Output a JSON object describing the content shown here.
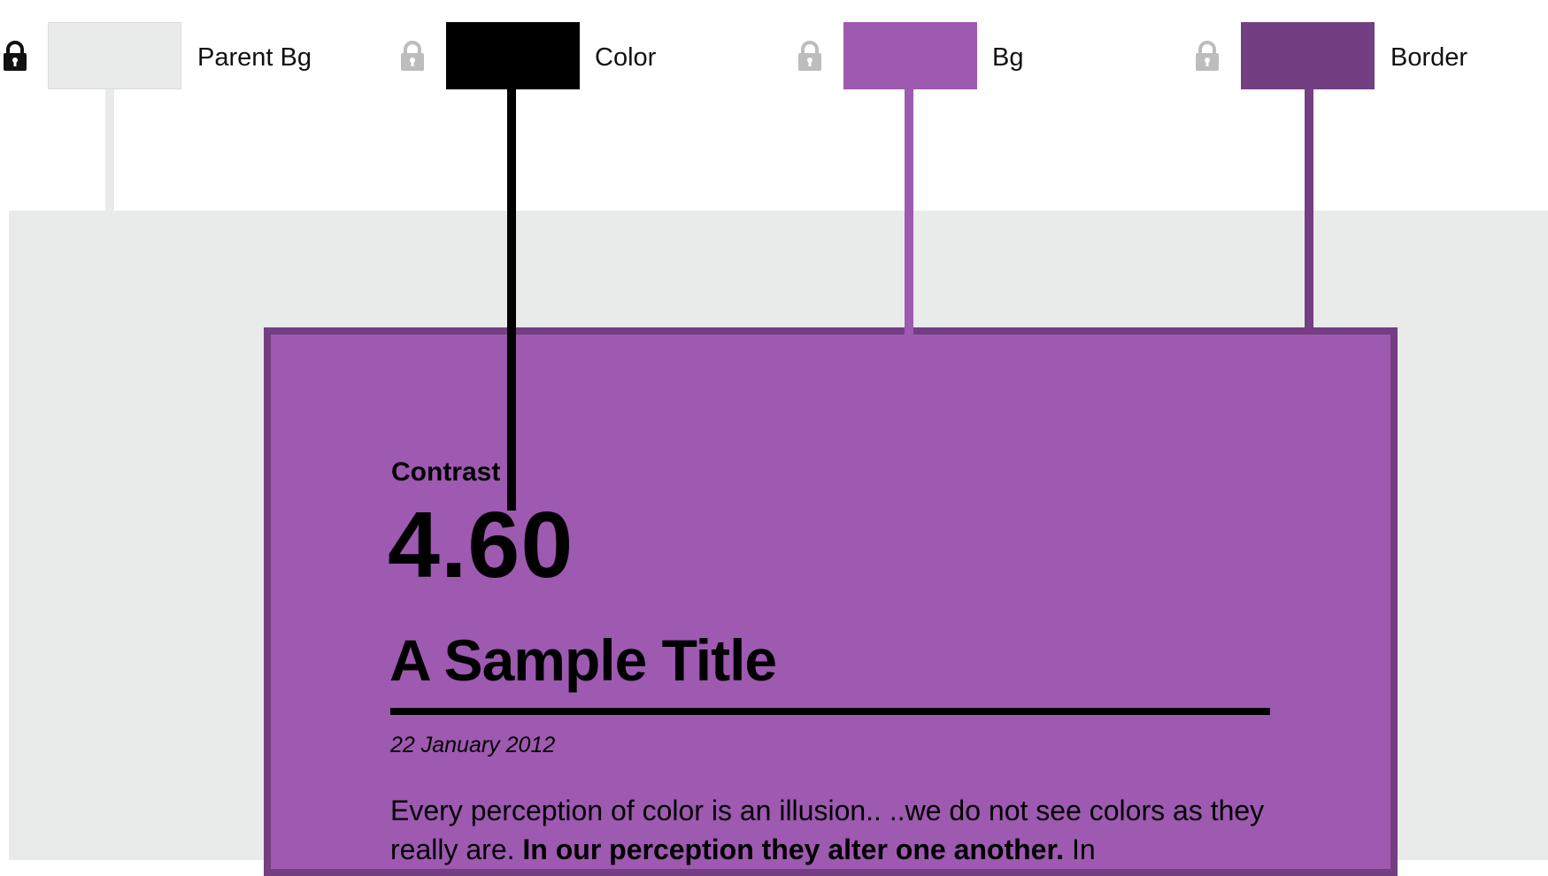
{
  "swatches": [
    {
      "label": "Parent Bg",
      "color": "#e9eaea",
      "locked": true
    },
    {
      "label": "Color",
      "color": "#000000",
      "locked": false
    },
    {
      "label": "Bg",
      "color": "#9e59b0",
      "locked": false
    },
    {
      "label": "Border",
      "color": "#743e82",
      "locked": false
    }
  ],
  "lock_icons": {
    "locked_color": "#111111",
    "unlocked_color": "#bdbdbd",
    "name": "lock-icon"
  },
  "preview": {
    "contrast_label": "Contrast",
    "contrast_value": "4.60",
    "title": "A Sample Title",
    "date": "22 January 2012",
    "body_part1": "Every perception of color is an illusion.. ..we do not see colors as they really are. ",
    "body_bold": "In our perception they alter one another.",
    "body_part2": " In"
  }
}
